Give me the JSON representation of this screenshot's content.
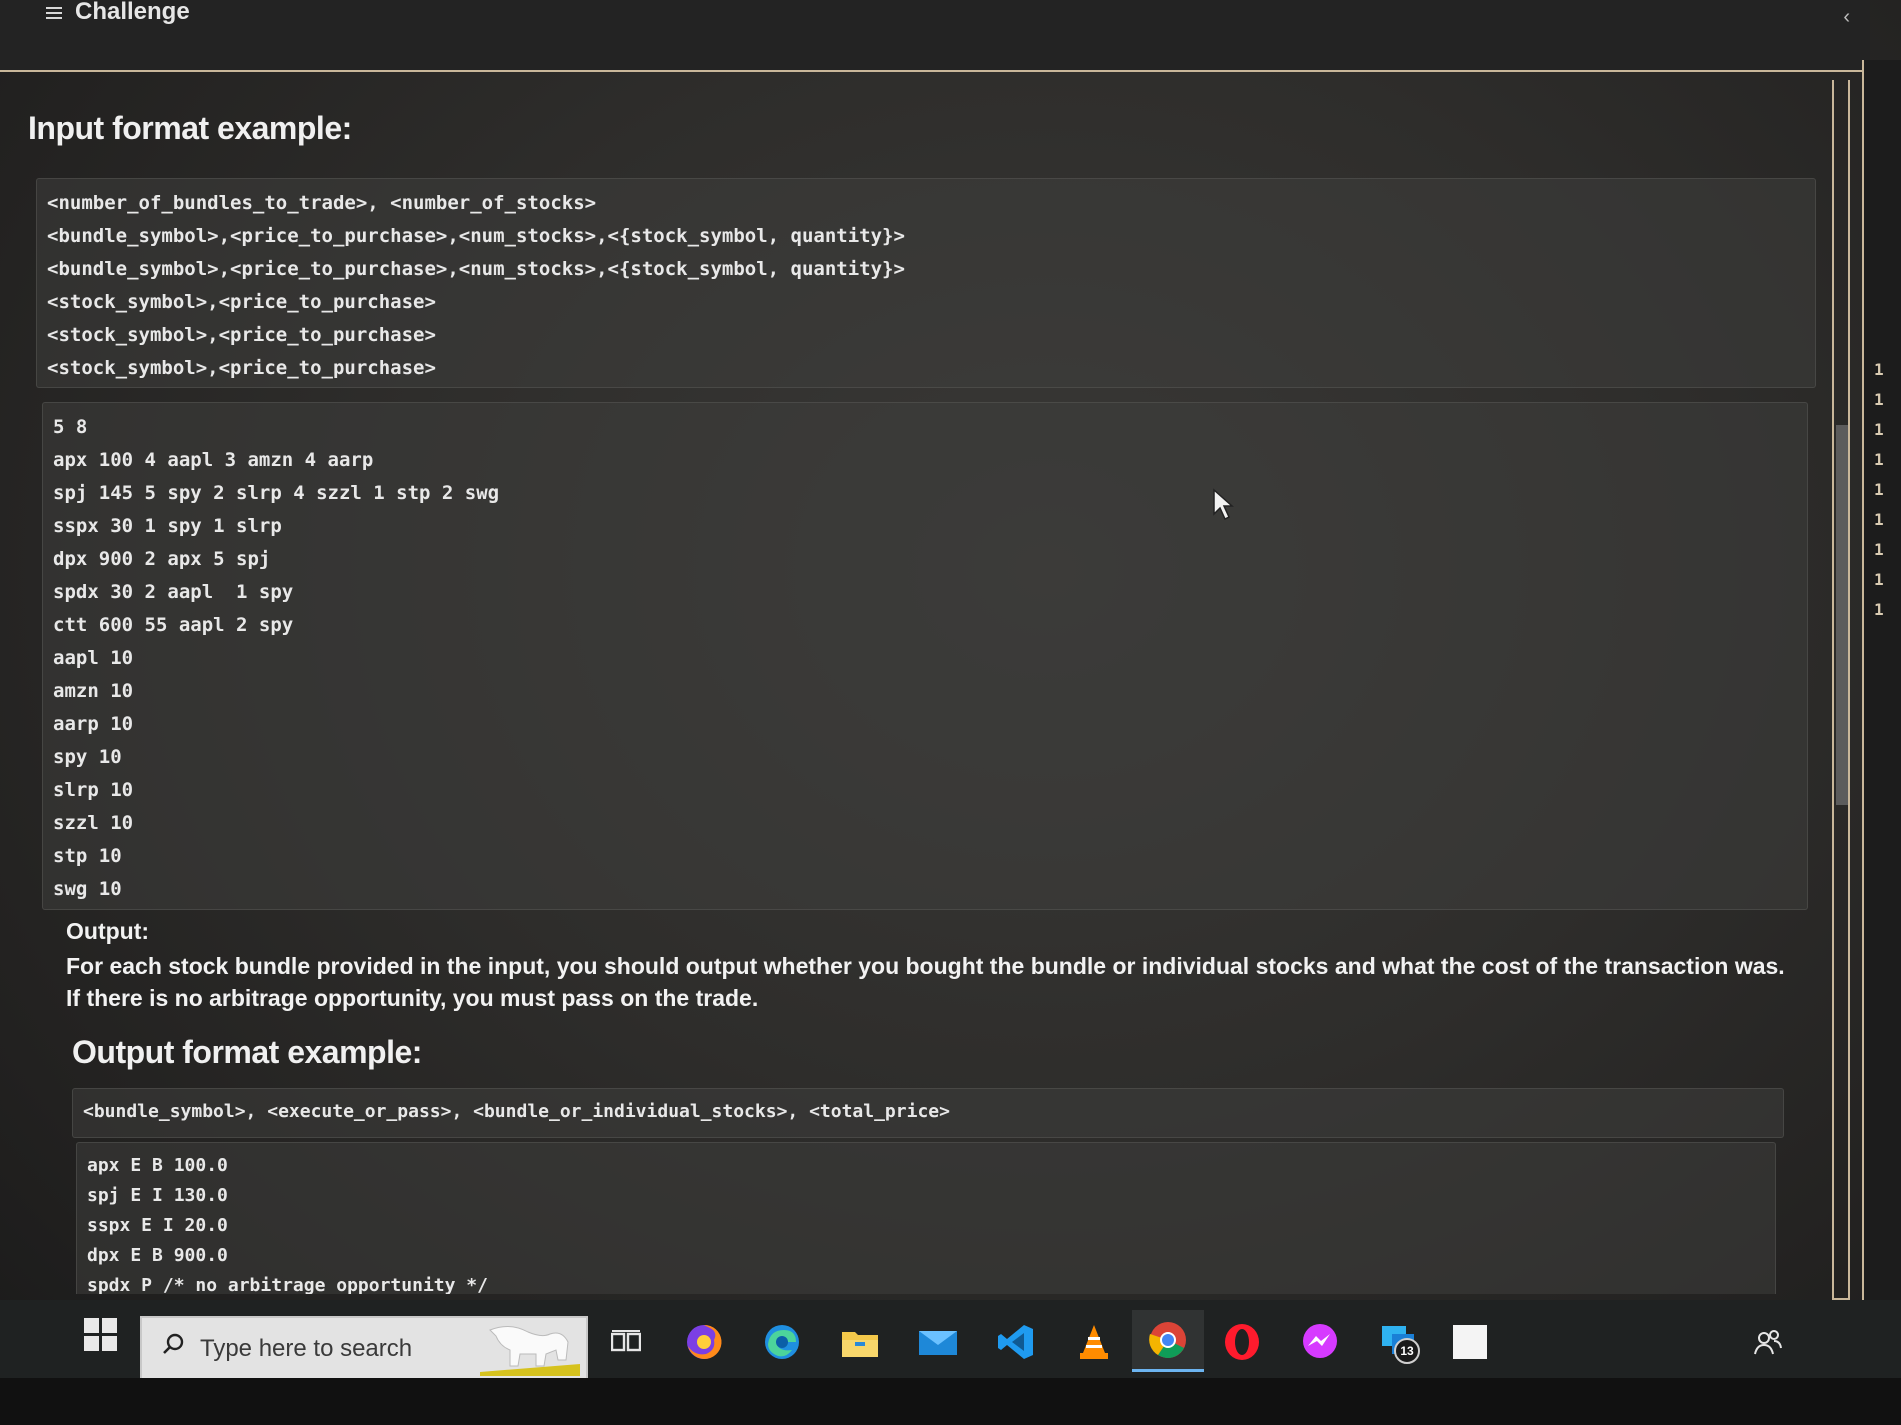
{
  "header": {
    "title": "Challenge"
  },
  "input_section": {
    "title": "Input format example:",
    "format_lines": [
      "<number_of_bundles_to_trade>, <number_of_stocks>",
      "<bundle_symbol>,<price_to_purchase>,<num_stocks>,<{stock_symbol, quantity}>",
      "<bundle_symbol>,<price_to_purchase>,<num_stocks>,<{stock_symbol, quantity}>",
      "<stock_symbol>,<price_to_purchase>",
      "<stock_symbol>,<price_to_purchase>",
      "<stock_symbol>,<price_to_purchase>"
    ],
    "example_lines": [
      "5 8",
      "apx 100 4 aapl 3 amzn 4 aarp",
      "spj 145 5 spy 2 slrp 4 szzl 1 stp 2 swg",
      "sspx 30 1 spy 1 slrp",
      "dpx 900 2 apx 5 spj",
      "spdx 30 2 aapl  1 spy",
      "ctt 600 55 aapl 2 spy",
      "aapl 10",
      "amzn 10",
      "aarp 10",
      "spy 10",
      "slrp 10",
      "szzl 10",
      "stp 10",
      "swg 10"
    ]
  },
  "output_section": {
    "label": "Output:",
    "description": "For each stock bundle provided in the input, you should output whether you bought the bundle or individual stocks and what the cost of the transaction was. If there is no arbitrage opportunity, you must pass on the trade.",
    "format_title": "Output format example:",
    "format_line": "<bundle_symbol>, <execute_or_pass>, <bundle_or_individual_stocks>, <total_price>",
    "example_lines": [
      "apx E B 100.0",
      "spj E I 130.0",
      "sspx E I 20.0",
      "dpx E B 900.0",
      "spdx P /* no arbitrage opportunity */"
    ]
  },
  "taskbar": {
    "search_placeholder": "Type here to search",
    "notification_count": "13",
    "icons": [
      "task-view-icon",
      "firefox-icon",
      "edge-icon",
      "file-explorer-icon",
      "mail-icon",
      "vscode-icon",
      "vlc-icon",
      "chrome-icon",
      "opera-icon",
      "messenger-icon",
      "remote-desktop-icon",
      "notepad-icon",
      "people-icon"
    ]
  },
  "right_edge_digits": [
    "1",
    "1",
    "1",
    "1",
    "1",
    "1",
    "1",
    "1",
    "1"
  ]
}
